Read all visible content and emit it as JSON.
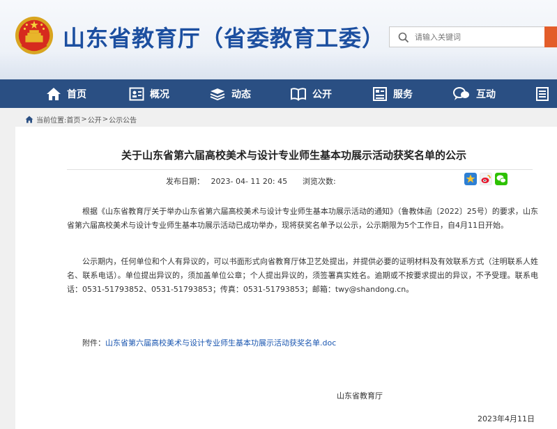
{
  "header": {
    "site_title": "山东省教育厅（省委教育工委）",
    "search_placeholder": "请输入关键词",
    "emblem_icon": "national-emblem-icon",
    "accent_color": "#1c4fa0",
    "search_button_color": "#e35d2a"
  },
  "nav": {
    "background_color": "#2a4f83",
    "items": [
      {
        "label": "首页",
        "icon": "home-icon"
      },
      {
        "label": "概况",
        "icon": "profile-icon"
      },
      {
        "label": "动态",
        "icon": "news-stack-icon"
      },
      {
        "label": "公开",
        "icon": "open-book-icon"
      },
      {
        "label": "服务",
        "icon": "service-doc-icon"
      },
      {
        "label": "互动",
        "icon": "chat-bubble-icon"
      },
      {
        "label": "",
        "icon": "list-doc-icon"
      }
    ]
  },
  "breadcrumb": {
    "prefix": "当前位置:",
    "items": [
      "首页",
      "公开",
      "公示公告"
    ],
    "separator": ">"
  },
  "article": {
    "title": "关于山东省第六届高校美术与设计专业师生基本功展示活动获奖名单的公示",
    "publish_label": "发布日期：",
    "publish_date": "2023- 04- 11 20: 45",
    "views_label": "浏览次数:",
    "share_icons": [
      "qzone-star-icon",
      "weibo-icon",
      "wechat-icon"
    ],
    "paragraphs": [
      "根据《山东省教育厅关于举办山东省第六届高校美术与设计专业师生基本功展示活动的通知》（鲁教体函〔2022〕25号）的要求，山东省第六届高校美术与设计专业师生基本功展示活动已成功举办，现将获奖名单予以公示，公示期限为5个工作日，自4月11日开始。",
      "公示期内，任何单位和个人有异议的，可以书面形式向省教育厅体卫艺处提出，并提供必要的证明材料及有效联系方式（注明联系人姓名、联系电话）。单位提出异议的，须加盖单位公章；个人提出异议的，须签署真实姓名。逾期或不按要求提出的异议，不予受理。联系电话：0531-51793852、0531-51793853；传真：0531-51793853；邮箱：twy@shandong.cn。"
    ],
    "attachment_label": "附件：",
    "attachment_link": "山东省第六届高校美术与设计专业师生基本功展示活动获奖名单.doc",
    "signature": "山东省教育厅",
    "sign_date": "2023年4月11日"
  }
}
